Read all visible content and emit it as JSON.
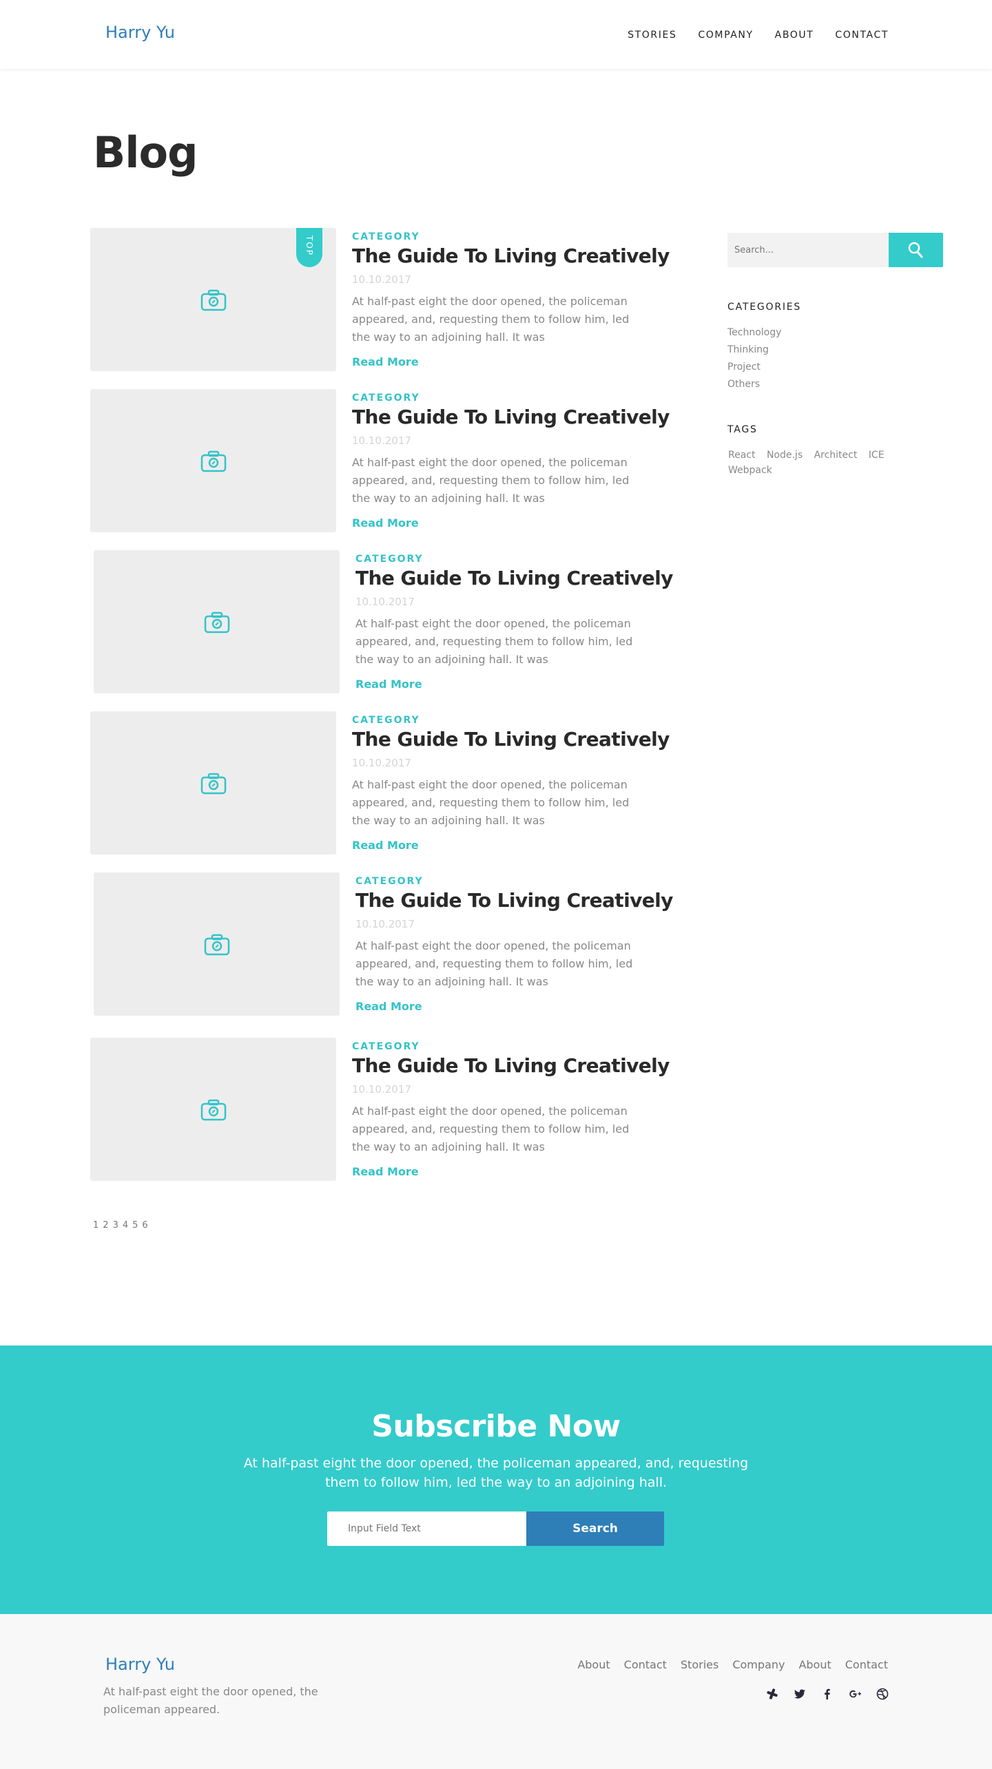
{
  "header": {
    "logo": "Harry Yu",
    "nav": [
      "STORIES",
      "COMPANY",
      "ABOUT",
      "CONTACT"
    ]
  },
  "page_title": "Blog",
  "posts": [
    {
      "category": "CATEGORY",
      "title": "The Guide To Living Creatively",
      "date": "10.10.2017",
      "excerpt": "At half-past eight the door opened, the policeman appeared, and, requesting them to follow him, led the way to an adjoining hall. It was",
      "read_more": "Read More",
      "badge": "TOP"
    },
    {
      "category": "CATEGORY",
      "title": "The Guide To Living Creatively",
      "date": "10.10.2017",
      "excerpt": "At half-past eight the door opened, the policeman appeared, and, requesting them to follow him, led the way to an adjoining hall. It was",
      "read_more": "Read More"
    },
    {
      "category": "CATEGORY",
      "title": "The Guide To Living Creatively",
      "date": "10.10.2017",
      "excerpt": "At half-past eight the door opened, the policeman appeared, and, requesting them to follow him, led the way to an adjoining hall. It was",
      "read_more": "Read More"
    },
    {
      "category": "CATEGORY",
      "title": "The Guide To Living Creatively",
      "date": "10.10.2017",
      "excerpt": "At half-past eight the door opened, the policeman appeared, and, requesting them to follow him, led the way to an adjoining hall. It was",
      "read_more": "Read More"
    },
    {
      "category": "CATEGORY",
      "title": "The Guide To Living Creatively",
      "date": "10.10.2017",
      "excerpt": "At half-past eight the door opened, the policeman appeared, and, requesting them to follow him, led the way to an adjoining hall. It was",
      "read_more": "Read More"
    },
    {
      "category": "CATEGORY",
      "title": "The Guide To Living Creatively",
      "date": "10.10.2017",
      "excerpt": "At half-past eight the door opened, the policeman appeared, and, requesting them to follow him, led the way to an adjoining hall. It was",
      "read_more": "Read More"
    }
  ],
  "pagination": [
    "1",
    "2",
    "3",
    "4",
    "5",
    "6"
  ],
  "sidebar": {
    "search_placeholder": "Search...",
    "categories_heading": "CATEGORIES",
    "categories": [
      "Technology",
      "Thinking",
      "Project",
      "Others"
    ],
    "tags_heading": "TAGS",
    "tags": [
      "React",
      "Node.js",
      "Architect",
      "ICE",
      "Webpack"
    ]
  },
  "subscribe": {
    "title": "Subscribe Now",
    "text": "At half-past eight the door opened, the policeman appeared, and, requesting them to follow him, led the way to an adjoining hall.",
    "input_placeholder": "Input Field Text",
    "button": "Search"
  },
  "footer": {
    "logo": "Harry Yu",
    "text": "At half-past eight the door opened, the policeman appeared.",
    "nav": [
      "About",
      "Contact",
      "Stories",
      "Company",
      "About",
      "Contact"
    ],
    "social_icons": [
      "slack-icon",
      "twitter-icon",
      "facebook-icon",
      "google-plus-icon",
      "dribbble-icon"
    ]
  },
  "colors": {
    "accent": "#34cbcb",
    "brand_blue": "#2e7eb8",
    "thumb_bg": "#ededed"
  }
}
